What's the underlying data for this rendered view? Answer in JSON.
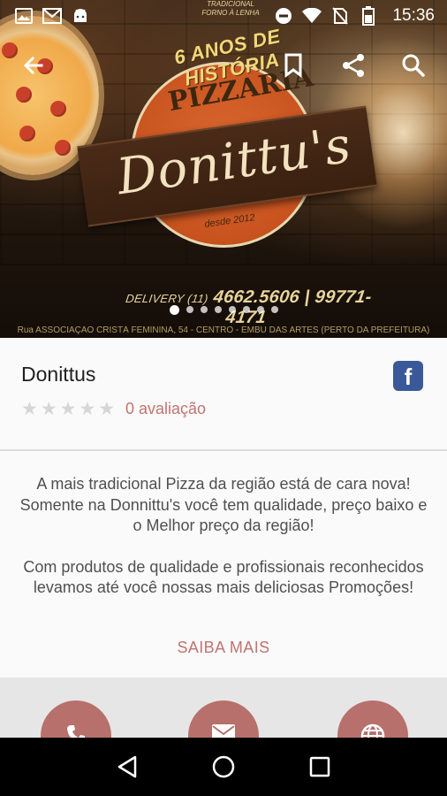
{
  "status_bar": {
    "time": "15:36",
    "left_icons": [
      "image-icon",
      "gmail-icon",
      "android-icon"
    ],
    "right_icons": [
      "do-not-disturb-icon",
      "wifi-icon",
      "no-sim-icon",
      "battery-icon"
    ]
  },
  "toolbar": {
    "icons": [
      "back-arrow-icon",
      "bookmark-icon",
      "share-icon",
      "search-icon"
    ]
  },
  "banner": {
    "top_badge_line1": "TRADICIONAL",
    "top_badge_line2": "FORNO À LENHA",
    "arc_text": "6 ANOS DE HISTÓRIA",
    "pizzaria": "PIZZARIA",
    "brand": "Donittu's",
    "desde": "desde 2012",
    "delivery_prefix": "DELIVERY (11)",
    "delivery_numbers": "4662.5606 | 99771-4171",
    "address": "Rua ASSOCIAÇÃO CRISTÃ FEMININA, 54 - CENTRO - EMBU DAS ARTES (PERTO DA PREFEITURA)",
    "carousel_count": 8,
    "carousel_active": 0
  },
  "listing": {
    "title": "Donittus",
    "rating_value": 0,
    "rating_max": 5,
    "rating_text": "0 avaliação",
    "facebook_icon_label": "f"
  },
  "description": {
    "paragraph1": "A mais tradicional Pizza da região está de cara nova! Somente na Donnittu's você tem qualidade, preço baixo e o Melhor preço da região!",
    "paragraph2": "Com produtos de qualidade e profissionais reconhecidos levamos até você nossas mais deliciosas Promoções!",
    "more_link": "SAIBA MAIS"
  },
  "actions": {
    "buttons": [
      "phone-icon",
      "email-icon",
      "globe-icon"
    ]
  },
  "navigation": {
    "buttons": [
      "back-icon",
      "home-icon",
      "recents-icon"
    ]
  },
  "colors": {
    "accent": "#c2736f",
    "action_button": "#b7706b",
    "facebook": "#3b5998",
    "star_empty": "#d6d6d6"
  }
}
